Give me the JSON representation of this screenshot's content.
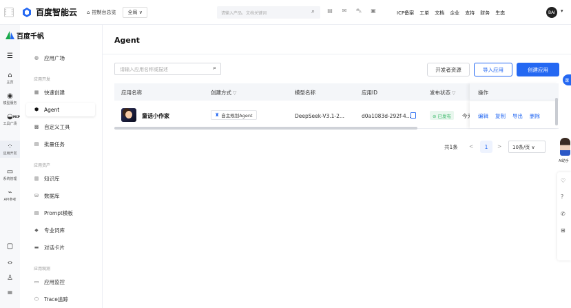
{
  "topbar": {
    "brand": "百度智能云",
    "console": "控制台总览",
    "region": "全局 ∨",
    "search_placeholder": "请输入产品、文档关键词",
    "links": [
      "ICP备案",
      "工单",
      "文档",
      "企业",
      "支持",
      "财务",
      "生态"
    ],
    "avatar_text": "BAI"
  },
  "product": {
    "name": "百度千帆"
  },
  "rail": [
    {
      "label": "",
      "icon": "menu-icon"
    },
    {
      "label": "主页",
      "icon": "home-icon"
    },
    {
      "label": "模型服务",
      "icon": "model-icon"
    },
    {
      "label": "工具广场",
      "icon": "tools-icon",
      "badge": "MCP"
    },
    {
      "label": "应用开发",
      "icon": "app-dev-icon"
    },
    {
      "label": "系统管理",
      "icon": "system-icon"
    },
    {
      "label": "API参考",
      "icon": "api-icon"
    }
  ],
  "sidebar": {
    "top_item": "应用广场",
    "group_dev": "应用开发",
    "dev_items": [
      "快速创建",
      "Agent",
      "自定义工具",
      "批量任务"
    ],
    "group_assets": "应用资产",
    "asset_items": [
      "知识库",
      "数据库",
      "Prompt模板",
      "专业词库",
      "对话卡片"
    ],
    "group_observe": "应用观测",
    "observe_items": [
      "应用监控",
      "Trace追踪"
    ]
  },
  "page": {
    "title": "Agent",
    "search_placeholder": "请输入应用名称或描述",
    "btn_dev": "开发者资源",
    "btn_import": "导入应用",
    "btn_create": "创建应用"
  },
  "table": {
    "headers": {
      "name": "应用名称",
      "create_mode": "创建方式",
      "model": "模型名称",
      "app_id": "应用ID",
      "status": "发布状态",
      "ops": "操作"
    },
    "rows": [
      {
        "name": "童话小作家",
        "create_mode": "自主规划Agent",
        "model": "DeepSeek-V3.1-2...",
        "app_id": "d0a1083d-292f-4...",
        "status": "已发布",
        "time": "今天",
        "ops": [
          "编辑",
          "复制",
          "导出",
          "删除"
        ]
      }
    ]
  },
  "pager": {
    "total": "共1条",
    "prev": "<",
    "page": "1",
    "next": ">",
    "size": "10条/页 ∨"
  },
  "floating": {
    "badge": "课",
    "ai_label": "AI助手"
  },
  "colors": {
    "accent": "#2468f2",
    "success": "#30b562"
  }
}
